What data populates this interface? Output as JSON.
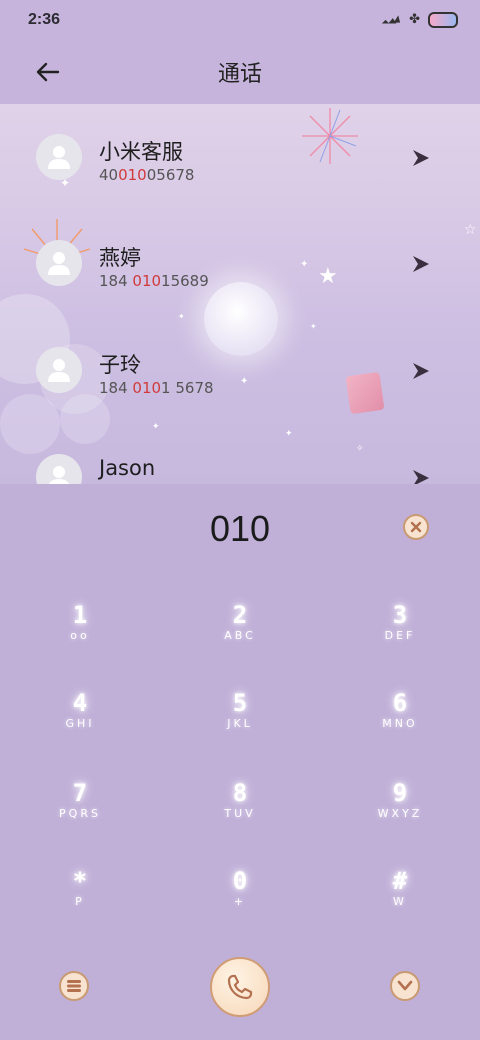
{
  "status_bar": {
    "time": "2:36"
  },
  "header": {
    "title": "通话"
  },
  "contacts": [
    {
      "name": "小米客服",
      "number_parts": [
        "40",
        "010",
        "05678"
      ]
    },
    {
      "name": "燕婷",
      "number_parts": [
        "184 ",
        "010",
        "15689"
      ]
    },
    {
      "name": "子玲",
      "number_parts": [
        "184 ",
        "010",
        "1 5678"
      ]
    },
    {
      "name": "Jason",
      "number_parts": [
        "",
        "",
        ""
      ]
    }
  ],
  "dialer": {
    "input_value": "010",
    "keys": [
      {
        "digit": "1",
        "letters": "oo"
      },
      {
        "digit": "2",
        "letters": "ABC"
      },
      {
        "digit": "3",
        "letters": "DEF"
      },
      {
        "digit": "4",
        "letters": "GHI"
      },
      {
        "digit": "5",
        "letters": "JKL"
      },
      {
        "digit": "6",
        "letters": "MNO"
      },
      {
        "digit": "7",
        "letters": "PQRS"
      },
      {
        "digit": "8",
        "letters": "TUV"
      },
      {
        "digit": "9",
        "letters": "WXYZ"
      },
      {
        "digit": "*",
        "letters": "P"
      },
      {
        "digit": "0",
        "letters": "+"
      },
      {
        "digit": "#",
        "letters": "W"
      }
    ]
  },
  "colors": {
    "highlight": "#d03a3a",
    "background": "#c0b0d8",
    "button_fill": "#f7e3d0",
    "button_border": "#c99a72"
  }
}
